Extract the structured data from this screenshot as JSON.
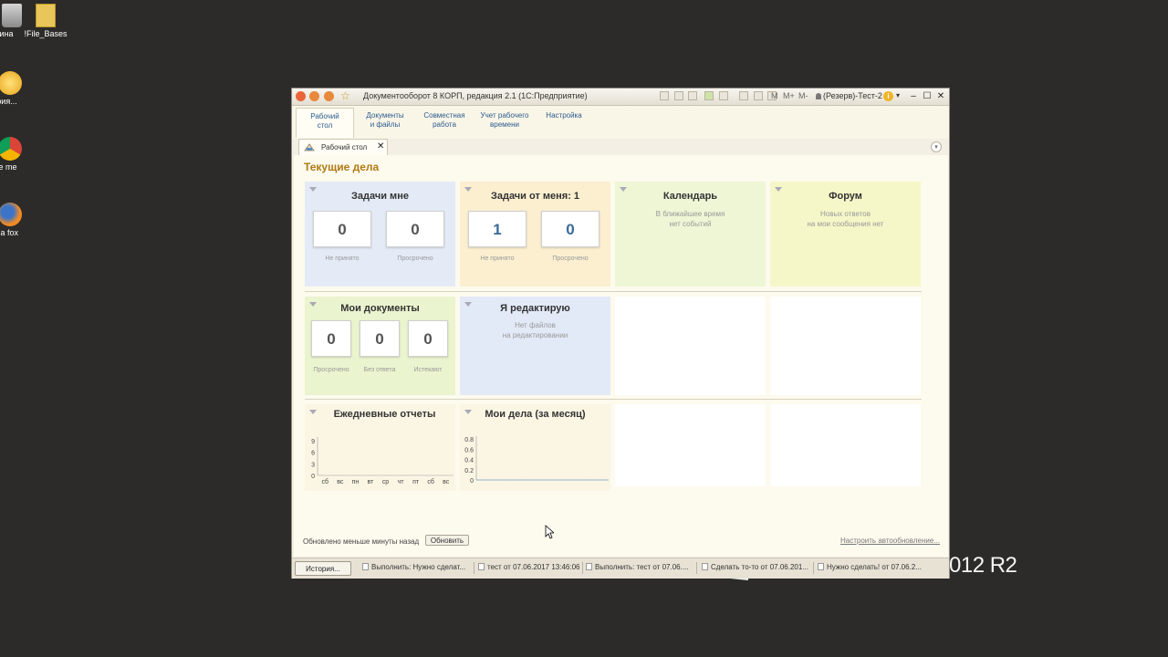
{
  "desktop": {
    "icons": [
      {
        "label": "зина"
      },
      {
        "label": "!File_Bases"
      },
      {
        "label": "ория..."
      },
      {
        "label": "gle me"
      },
      {
        "label": "zilla fox"
      }
    ],
    "os_label": "012 R2"
  },
  "window": {
    "title": "Документооборот 8 КОРП, редакция 2.1  (1С:Предприятие)",
    "user": "(Резерв)-Тест-2",
    "toolbar_m": [
      "M",
      "M+",
      "M-"
    ]
  },
  "sections": [
    {
      "label": "Рабочий стол"
    },
    {
      "label": "Документы и файлы"
    },
    {
      "label": "Совместная работа"
    },
    {
      "label": "Учет рабочего времени"
    },
    {
      "label": "Настройка"
    }
  ],
  "tab": {
    "label": "Рабочий стол"
  },
  "page_title": "Текущие дела",
  "widgets": {
    "tasks_me": {
      "title": "Задачи мне",
      "counters": [
        {
          "value": "0",
          "label": "Не принято"
        },
        {
          "value": "0",
          "label": "Просрочено"
        }
      ]
    },
    "tasks_from_me": {
      "title": "Задачи от меня: 1",
      "counters": [
        {
          "value": "1",
          "label": "Не принято"
        },
        {
          "value": "0",
          "label": "Просрочено"
        }
      ]
    },
    "calendar": {
      "title": "Календарь",
      "message_line1": "В ближайшее время",
      "message_line2": "нет событий"
    },
    "forum": {
      "title": "Форум",
      "message_line1": "Новых ответов",
      "message_line2": "на мои сообщения нет"
    },
    "my_docs": {
      "title": "Мои документы",
      "counters": [
        {
          "value": "0",
          "label": "Просрочено"
        },
        {
          "value": "0",
          "label": "Без ответа"
        },
        {
          "value": "0",
          "label": "Истекают"
        }
      ]
    },
    "editing": {
      "title": "Я редактирую",
      "message_line1": "Нет файлов",
      "message_line2": "на редактировании"
    }
  },
  "chart_data": [
    {
      "type": "bar",
      "title": "Ежедневные отчеты",
      "categories": [
        "сб",
        "вс",
        "пн",
        "вт",
        "ср",
        "чт",
        "пт",
        "сб",
        "вс"
      ],
      "values": [
        0,
        0,
        0,
        0,
        0,
        0,
        0,
        0,
        0
      ],
      "ylim": [
        0,
        9
      ],
      "yticks": [
        "0",
        "3",
        "6",
        "9"
      ]
    },
    {
      "type": "line",
      "title": "Мои дела (за месяц)",
      "values": [
        0,
        0,
        0,
        0,
        0,
        0,
        0,
        0,
        0,
        0,
        0,
        0,
        0,
        0,
        0,
        0,
        0,
        0,
        0,
        0,
        0,
        0,
        0,
        0,
        0,
        0,
        0,
        0,
        0,
        0
      ],
      "ylim": [
        0,
        0.8
      ],
      "yticks": [
        "0",
        "0.2",
        "0.4",
        "0.6",
        "0.8"
      ]
    }
  ],
  "footer": {
    "status": "Обновлено меньше минуты назад",
    "refresh_label": "Обновить",
    "autorefresh_label": "Настроить автообновление..."
  },
  "history": {
    "button_label": "История...",
    "items": [
      {
        "label": "Выполнить: Нужно сделат..."
      },
      {
        "label": "тест от 07.06.2017 13:46:06"
      },
      {
        "label": "Выполнить: тест от 07.06...."
      },
      {
        "label": "Сделать то-то от 07.06.201..."
      },
      {
        "label": "Нужно сделать! от 07.06.2..."
      }
    ]
  },
  "colors": {
    "tasks_me_bg": "#e4ebf7",
    "tasks_from_me_bg": "#fbefd0",
    "calendar_bg": "#eef6d6",
    "forum_bg": "#f6f7c8",
    "my_docs_bg": "#eaf4cf",
    "editing_bg": "#e3eaf7"
  }
}
